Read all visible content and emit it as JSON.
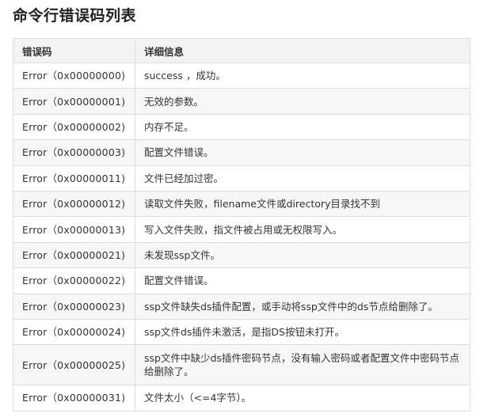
{
  "page": {
    "title": "命令行错误码列表"
  },
  "table": {
    "headers": [
      "错误码",
      "详细信息"
    ],
    "rows": [
      {
        "code": "Error（0x00000000)",
        "desc": "success ，成功。"
      },
      {
        "code": "Error（0x00000001)",
        "desc": "无效的参数。"
      },
      {
        "code": "Error（0x00000002)",
        "desc": "内存不足。"
      },
      {
        "code": "Error（0x00000003)",
        "desc": "配置文件错误。"
      },
      {
        "code": "Error（0x00000011)",
        "desc": "文件已经加过密。"
      },
      {
        "code": "Error（0x00000012)",
        "desc": "读取文件失败，filename文件或directory目录找不到"
      },
      {
        "code": "Error（0x00000013)",
        "desc": "写入文件失败，指文件被占用或无权限写入。"
      },
      {
        "code": "Error（0x00000021)",
        "desc": "未发现ssp文件。"
      },
      {
        "code": "Error（0x00000022)",
        "desc": "配置文件错误。"
      },
      {
        "code": "Error（0x00000023)",
        "desc": "ssp文件缺失ds插件配置，或手动将ssp文件中的ds节点给删除了。"
      },
      {
        "code": "Error（0x00000024)",
        "desc": "ssp文件ds插件未激活，是指DS按钮未打开。"
      },
      {
        "code": "Error（0x00000025)",
        "desc": "ssp文件中缺少ds插件密码节点，没有输入密码或者配置文件中密码节点给删除了。"
      },
      {
        "code": "Error（0x00000031)",
        "desc": "文件太小（<=4字节）。"
      }
    ]
  }
}
